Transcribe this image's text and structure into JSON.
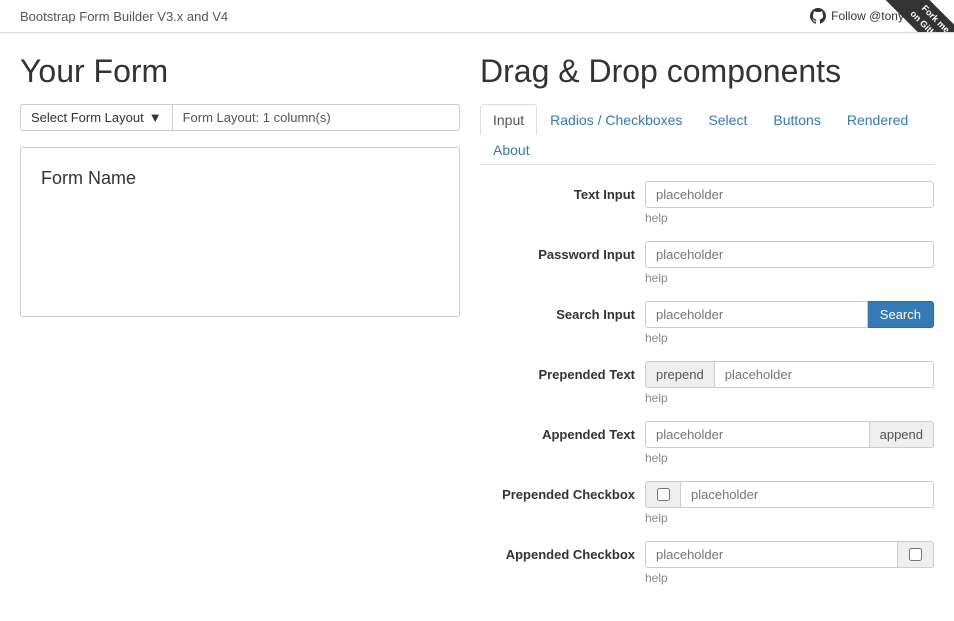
{
  "header": {
    "title": "Bootstrap Form Builder V3.x and V4",
    "github_label": "Follow @tonytam...",
    "ribbon_line1": "Fork me",
    "ribbon_line2": "on GitHub"
  },
  "left_panel": {
    "heading": "Your Form",
    "select_layout_label": "Select Form Layout",
    "form_layout_info": "Form Layout: 1 column(s)",
    "form_name": "Form Name"
  },
  "right_panel": {
    "heading": "Drag & Drop components",
    "tabs": [
      {
        "id": "input",
        "label": "Input",
        "active": true
      },
      {
        "id": "radios",
        "label": "Radios / Checkboxes",
        "active": false
      },
      {
        "id": "select",
        "label": "Select",
        "active": false
      },
      {
        "id": "buttons",
        "label": "Buttons",
        "active": false
      },
      {
        "id": "rendered",
        "label": "Rendered",
        "active": false
      },
      {
        "id": "about",
        "label": "About",
        "active": false
      }
    ],
    "components": [
      {
        "id": "text-input",
        "label": "Text Input",
        "type": "text",
        "placeholder": "placeholder",
        "help": "help"
      },
      {
        "id": "password-input",
        "label": "Password Input",
        "type": "password",
        "placeholder": "placeholder",
        "help": "help"
      },
      {
        "id": "search-input",
        "label": "Search Input",
        "type": "search",
        "placeholder": "placeholder",
        "button_label": "Search",
        "help": "help"
      },
      {
        "id": "prepended-text",
        "label": "Prepended Text",
        "type": "prepend",
        "addon": "prepend",
        "placeholder": "placeholder",
        "help": "help"
      },
      {
        "id": "appended-text",
        "label": "Appended Text",
        "type": "append",
        "placeholder": "placeholder",
        "addon": "append",
        "help": "help"
      },
      {
        "id": "prepended-checkbox",
        "label": "Prepended Checkbox",
        "type": "prepend-checkbox",
        "placeholder": "placeholder",
        "help": "help"
      },
      {
        "id": "appended-checkbox",
        "label": "Appended Checkbox",
        "type": "append-checkbox",
        "placeholder": "placeholder",
        "help": "help"
      }
    ]
  },
  "colors": {
    "primary": "#337ab7",
    "link": "#337ab7",
    "active_tab_border": "#ddd"
  }
}
